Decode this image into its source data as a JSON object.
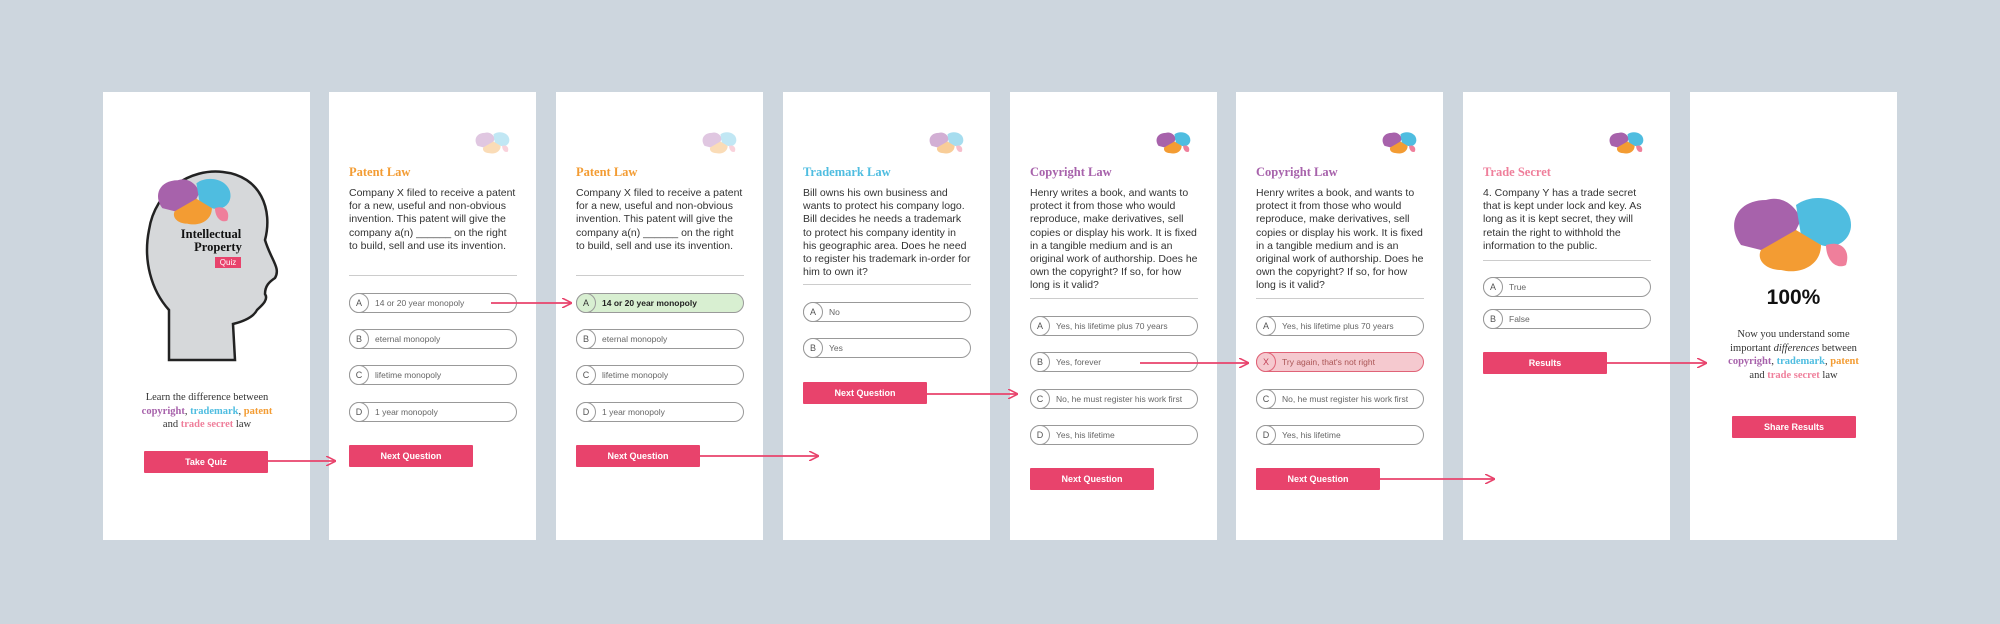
{
  "colors": {
    "copyright": "#a762ab",
    "trademark": "#4fbde0",
    "patent": "#f39c33",
    "trade_secret": "#ef7f9b",
    "button": "#e8436c",
    "background": "#cdd6de"
  },
  "intro": {
    "title_line1": "Intellectual",
    "title_line2": "Property",
    "quiz_badge": "Quiz",
    "desc_before": "Learn the difference between",
    "copyright": "copyright",
    "trademark": "trademark",
    "patent": "patent",
    "and": "and",
    "trade_secret": "trade secret",
    "law": "law",
    "button": "Take Quiz"
  },
  "screen2": {
    "category": "Patent Law",
    "question": "Company X filed to receive a patent for a new, useful and non-obvious invention. This patent will give the company a(n) ______ on the right to build, sell and use its invention.",
    "options": [
      {
        "letter": "A",
        "text": "14 or 20 year monopoly"
      },
      {
        "letter": "B",
        "text": "eternal monopoly"
      },
      {
        "letter": "C",
        "text": "lifetime monopoly"
      },
      {
        "letter": "D",
        "text": "1 year monopoly"
      }
    ],
    "button": "Next Question"
  },
  "screen3": {
    "category": "Patent Law",
    "question": "Company X filed to receive a patent for a new, useful and non-obvious invention. This patent will give the company a(n) ______ on the right to build, sell and use its invention.",
    "options": [
      {
        "letter": "A",
        "text": "14 or 20 year monopoly"
      },
      {
        "letter": "B",
        "text": "eternal monopoly"
      },
      {
        "letter": "C",
        "text": "lifetime monopoly"
      },
      {
        "letter": "D",
        "text": "1 year monopoly"
      }
    ],
    "button": "Next Question"
  },
  "screen4": {
    "category": "Trademark Law",
    "question": "Bill owns his own business and wants to protect his company logo. Bill decides he needs a trademark to protect his company identity in his geographic area. Does he need to register his trademark in-order for him to own it?",
    "options": [
      {
        "letter": "A",
        "text": "No"
      },
      {
        "letter": "B",
        "text": "Yes"
      }
    ],
    "button": "Next Question"
  },
  "screen5": {
    "category": "Copyright Law",
    "question": "Henry writes a book, and wants to protect it from those who would reproduce, make derivatives, sell copies or display his work. It is fixed in a tangible medium and is an original work of authorship. Does he own the copyright? If so, for how long is it valid?",
    "options": [
      {
        "letter": "A",
        "text": "Yes, his lifetime plus 70 years"
      },
      {
        "letter": "B",
        "text": "Yes, forever"
      },
      {
        "letter": "C",
        "text": "No, he must register his work first"
      },
      {
        "letter": "D",
        "text": "Yes, his lifetime"
      }
    ],
    "button": "Next Question"
  },
  "screen6": {
    "category": "Copyright Law",
    "question": "Henry writes a book, and wants to protect it from those who would reproduce, make derivatives, sell copies or display his work. It is fixed in a tangible medium and is an original work of authorship. Does he own the copyright? If so, for how long is it valid?",
    "options": [
      {
        "letter": "A",
        "text": "Yes, his lifetime plus 70 years"
      },
      {
        "letter": "X",
        "text": "Try again, that's not right"
      },
      {
        "letter": "C",
        "text": "No, he must register his work first"
      },
      {
        "letter": "D",
        "text": "Yes, his lifetime"
      }
    ],
    "button": "Next Question"
  },
  "screen7": {
    "category": "Trade Secret",
    "question": "4. Company Y has a trade secret that is kept under lock and key. As long as it is kept secret, they will retain the right to withhold the information to the public.",
    "options": [
      {
        "letter": "A",
        "text": "True"
      },
      {
        "letter": "B",
        "text": "False"
      }
    ],
    "button": "Results"
  },
  "results": {
    "score": "100%",
    "line1": "Now you understand some",
    "line2a": "important",
    "line2b": "differences",
    "line2c": "between",
    "copyright": "copyright",
    "trademark": "trademark",
    "patent": "patent",
    "and": "and",
    "trade_secret": "trade secret",
    "law": "law",
    "button": "Share Results"
  }
}
